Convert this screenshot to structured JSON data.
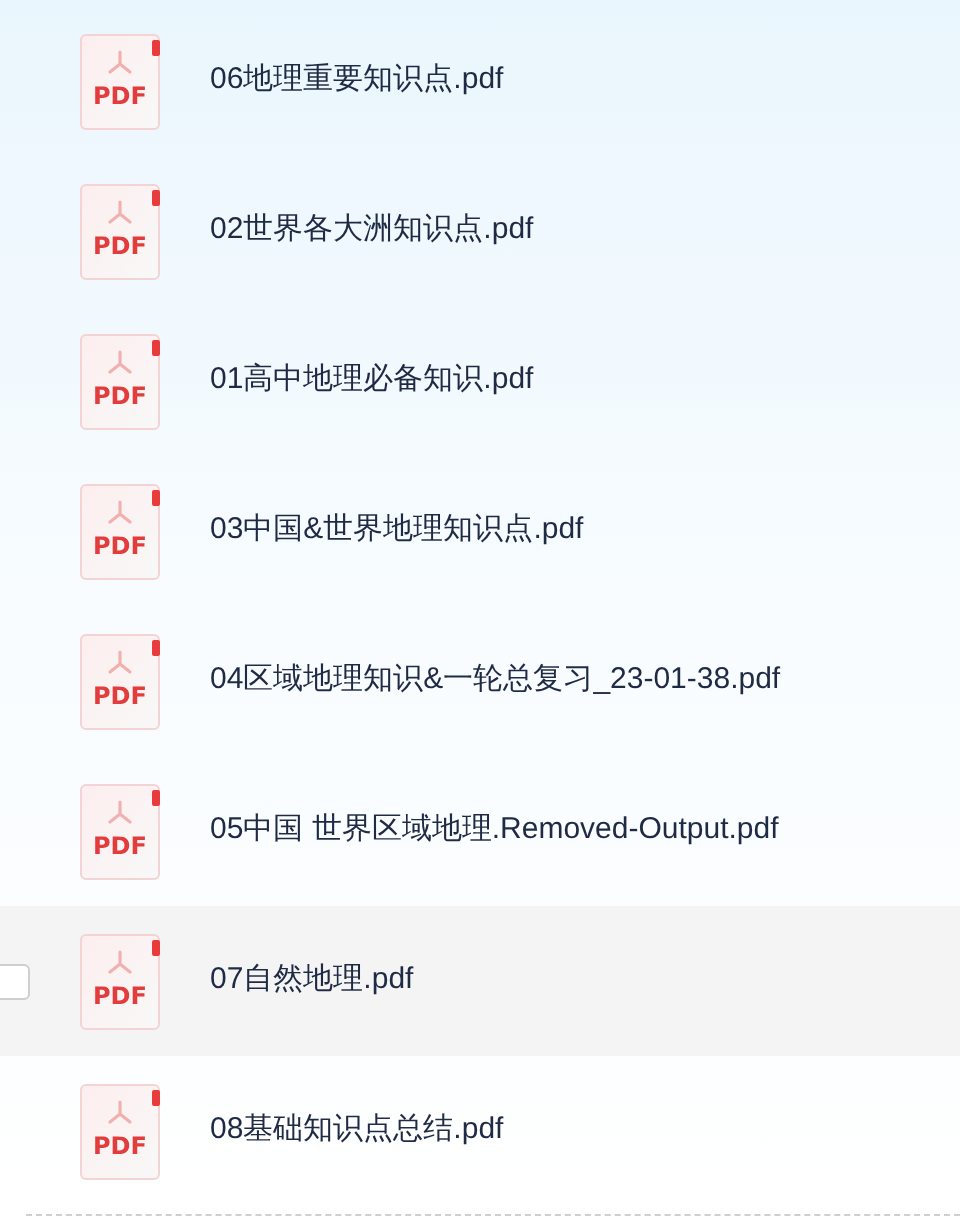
{
  "files": [
    {
      "name": "06地理重要知识点.pdf",
      "badge": "PDF",
      "hovered": false
    },
    {
      "name": "02世界各大洲知识点.pdf",
      "badge": "PDF",
      "hovered": false
    },
    {
      "name": "01高中地理必备知识.pdf",
      "badge": "PDF",
      "hovered": false
    },
    {
      "name": "03中国&世界地理知识点.pdf",
      "badge": "PDF",
      "hovered": false
    },
    {
      "name": "04区域地理知识&一轮总复习_23-01-38.pdf",
      "badge": "PDF",
      "hovered": false
    },
    {
      "name": "05中国 世界区域地理.Removed-Output.pdf",
      "badge": "PDF",
      "hovered": false
    },
    {
      "name": "07自然地理.pdf",
      "badge": "PDF",
      "hovered": true,
      "checkbox": {
        "checked": false
      }
    },
    {
      "name": "08基础知识点总结.pdf",
      "badge": "PDF",
      "hovered": false
    }
  ]
}
